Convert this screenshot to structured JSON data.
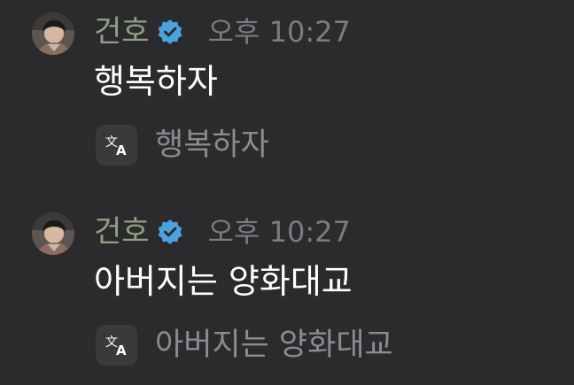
{
  "messages": [
    {
      "author": "건호",
      "time": "오후 10:27",
      "text": "행복하자",
      "translation": "행복하자"
    },
    {
      "author": "건호",
      "time": "오후 10:27",
      "text": "아버지는 양화대교",
      "translation": "아버지는 양화대교"
    }
  ],
  "icons": {
    "avatar": "avatar-photo",
    "verified": "verified-badge-icon",
    "translate": "translate-icon"
  },
  "colors": {
    "background": "#2b2b2d",
    "author": "#8fa084",
    "verified": "#4aa3df",
    "timestamp": "#7b7b80",
    "message_text": "#ffffff",
    "translation_text": "#8b8b90",
    "translate_button_bg": "#3a3a3c"
  }
}
